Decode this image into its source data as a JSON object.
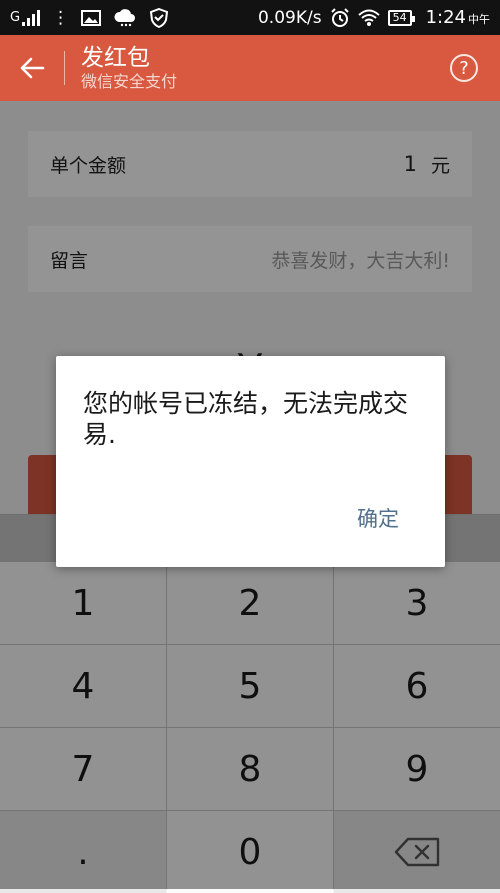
{
  "status_bar": {
    "carrier_label": "G",
    "network_speed": "0.09K/s",
    "battery": "54",
    "time": "1:24",
    "time_suffix": "中午"
  },
  "header": {
    "title": "发红包",
    "subtitle": "微信安全支付",
    "help_label": "?"
  },
  "form": {
    "amount_label": "单个金额",
    "amount_value": "1",
    "amount_unit": "元",
    "message_label": "留言",
    "message_placeholder": "恭喜发财，大吉大利!",
    "amount_display": "¥"
  },
  "keypad": {
    "keys": [
      "1",
      "2",
      "3",
      "4",
      "5",
      "6",
      "7",
      "8",
      "9",
      ".",
      "0"
    ]
  },
  "dialog": {
    "message": "您的帐号已冻结，无法完成交易.",
    "confirm_label": "确定"
  },
  "colors": {
    "brand": "#d85940",
    "link": "#52708f"
  }
}
